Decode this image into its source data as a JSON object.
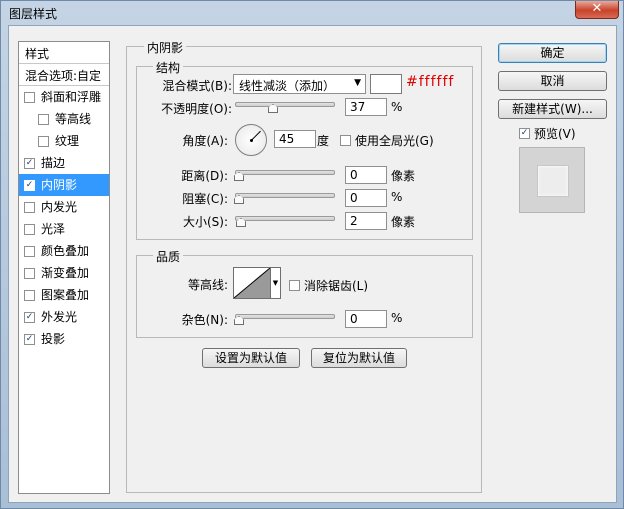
{
  "window": {
    "title": "图层样式",
    "close_glyph": "✕"
  },
  "sidebar": {
    "header": "样式",
    "blend_options": "混合选项:自定",
    "items": [
      {
        "label": "斜面和浮雕",
        "checked": false,
        "sub": false,
        "selected": false
      },
      {
        "label": "等高线",
        "checked": false,
        "sub": true,
        "selected": false
      },
      {
        "label": "纹理",
        "checked": false,
        "sub": true,
        "selected": false
      },
      {
        "label": "描边",
        "checked": true,
        "sub": false,
        "selected": false
      },
      {
        "label": "内阴影",
        "checked": true,
        "sub": false,
        "selected": true
      },
      {
        "label": "内发光",
        "checked": false,
        "sub": false,
        "selected": false
      },
      {
        "label": "光泽",
        "checked": false,
        "sub": false,
        "selected": false
      },
      {
        "label": "颜色叠加",
        "checked": false,
        "sub": false,
        "selected": false
      },
      {
        "label": "渐变叠加",
        "checked": false,
        "sub": false,
        "selected": false
      },
      {
        "label": "图案叠加",
        "checked": false,
        "sub": false,
        "selected": false
      },
      {
        "label": "外发光",
        "checked": true,
        "sub": false,
        "selected": false
      },
      {
        "label": "投影",
        "checked": true,
        "sub": false,
        "selected": false
      }
    ]
  },
  "panel": {
    "title": "内阴影",
    "structure": {
      "title": "结构",
      "blend_mode_label": "混合模式(B):",
      "blend_mode_value": "线性减淡（添加）",
      "color_hex_note": "#ffffff",
      "opacity_label": "不透明度(O):",
      "opacity_value": "37",
      "opacity_unit": "%",
      "opacity_fraction": 0.37,
      "angle_label": "角度(A):",
      "angle_value": "45",
      "angle_unit": "度",
      "global_light_label": "使用全局光(G)",
      "global_light_checked": false,
      "distance_label": "距离(D):",
      "distance_value": "0",
      "distance_unit": "像素",
      "choke_label": "阻塞(C):",
      "choke_value": "0",
      "choke_unit": "%",
      "size_label": "大小(S):",
      "size_value": "2",
      "size_unit": "像素"
    },
    "quality": {
      "title": "品质",
      "contour_label": "等高线:",
      "anti_alias_label": "消除锯齿(L)",
      "anti_alias_checked": false,
      "noise_label": "杂色(N):",
      "noise_value": "0",
      "noise_unit": "%"
    },
    "make_default_label": "设置为默认值",
    "reset_default_label": "复位为默认值"
  },
  "actions": {
    "ok_label": "确定",
    "cancel_label": "取消",
    "new_style_label": "新建样式(W)...",
    "preview_label": "预览(V)",
    "preview_checked": true
  },
  "icons": {
    "check": "✓",
    "dropdown": "▼"
  },
  "colors": {
    "selection": "#3399ff",
    "hex_note": "#e00000",
    "shadow_color": "#ffffff"
  }
}
